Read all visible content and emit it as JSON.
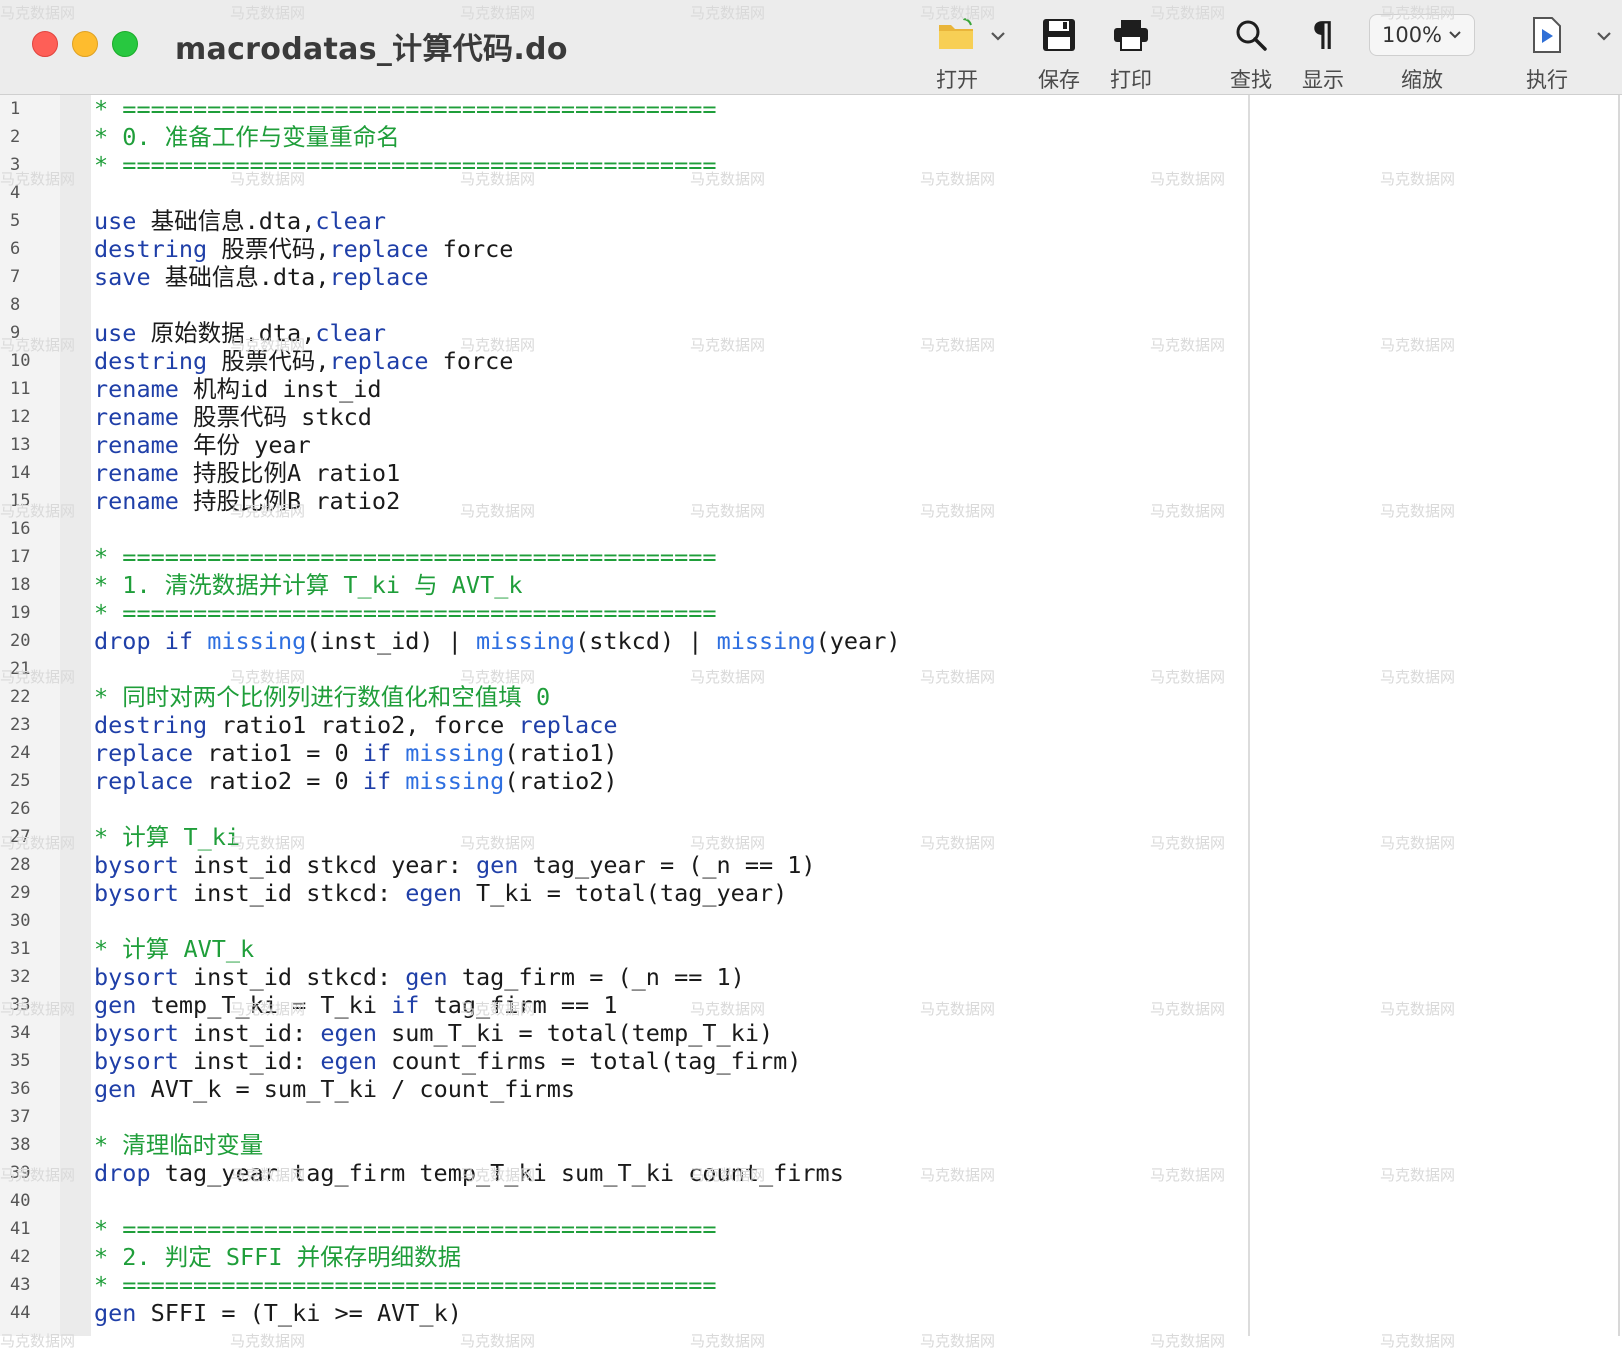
{
  "window": {
    "title": "macrodatas_计算代码.do"
  },
  "toolbar": {
    "open_label": "打开",
    "save_label": "保存",
    "print_label": "打印",
    "find_label": "查找",
    "show_label": "显示",
    "zoom_label": "缩放",
    "zoom_value": "100%",
    "run_label": "执行"
  },
  "watermark_text": "马克数据网",
  "colors": {
    "keyword": "#1f3fa8",
    "function": "#2e6fe0",
    "comment": "#1f9e3a",
    "text": "#1a1a1a"
  },
  "editor": {
    "lines": [
      [
        [
          "c",
          "* =========================================="
        ]
      ],
      [
        [
          "c",
          "* 0. 准备工作与变量重命名"
        ]
      ],
      [
        [
          "c",
          "* =========================================="
        ]
      ],
      [],
      [
        [
          "k",
          "use"
        ],
        [
          "p",
          " 基础信息.dta,"
        ],
        [
          "k",
          "clear"
        ]
      ],
      [
        [
          "k",
          "destring"
        ],
        [
          "p",
          " 股票代码,"
        ],
        [
          "k",
          "replace"
        ],
        [
          "p",
          " force"
        ]
      ],
      [
        [
          "k",
          "save"
        ],
        [
          "p",
          " 基础信息.dta,"
        ],
        [
          "k",
          "replace"
        ]
      ],
      [],
      [
        [
          "k",
          "use"
        ],
        [
          "p",
          " 原始数据.dta,"
        ],
        [
          "k",
          "clear"
        ]
      ],
      [
        [
          "k",
          "destring"
        ],
        [
          "p",
          " 股票代码,"
        ],
        [
          "k",
          "replace"
        ],
        [
          "p",
          " force"
        ]
      ],
      [
        [
          "k",
          "rename"
        ],
        [
          "p",
          " 机构id inst_id"
        ]
      ],
      [
        [
          "k",
          "rename"
        ],
        [
          "p",
          " 股票代码 stkcd"
        ]
      ],
      [
        [
          "k",
          "rename"
        ],
        [
          "p",
          " 年份 year"
        ]
      ],
      [
        [
          "k",
          "rename"
        ],
        [
          "p",
          " 持股比例A ratio1"
        ]
      ],
      [
        [
          "k",
          "rename"
        ],
        [
          "p",
          " 持股比例B ratio2"
        ]
      ],
      [],
      [
        [
          "c",
          "* =========================================="
        ]
      ],
      [
        [
          "c",
          "* 1. 清洗数据并计算 T_ki 与 AVT_k"
        ]
      ],
      [
        [
          "c",
          "* =========================================="
        ]
      ],
      [
        [
          "k",
          "drop"
        ],
        [
          "p",
          " "
        ],
        [
          "k",
          "if"
        ],
        [
          "p",
          " "
        ],
        [
          "f",
          "missing"
        ],
        [
          "p",
          "(inst_id) | "
        ],
        [
          "f",
          "missing"
        ],
        [
          "p",
          "(stkcd) | "
        ],
        [
          "f",
          "missing"
        ],
        [
          "p",
          "(year)"
        ]
      ],
      [],
      [
        [
          "c",
          "* 同时对两个比例列进行数值化和空值填 0"
        ]
      ],
      [
        [
          "k",
          "destring"
        ],
        [
          "p",
          " ratio1 ratio2, force "
        ],
        [
          "k",
          "replace"
        ]
      ],
      [
        [
          "k",
          "replace"
        ],
        [
          "p",
          " ratio1 = 0 "
        ],
        [
          "k",
          "if"
        ],
        [
          "p",
          " "
        ],
        [
          "f",
          "missing"
        ],
        [
          "p",
          "(ratio1)"
        ]
      ],
      [
        [
          "k",
          "replace"
        ],
        [
          "p",
          " ratio2 = 0 "
        ],
        [
          "k",
          "if"
        ],
        [
          "p",
          " "
        ],
        [
          "f",
          "missing"
        ],
        [
          "p",
          "(ratio2)"
        ]
      ],
      [],
      [
        [
          "c",
          "* 计算 T_ki"
        ]
      ],
      [
        [
          "k",
          "bysort"
        ],
        [
          "p",
          " inst_id stkcd year: "
        ],
        [
          "k",
          "gen"
        ],
        [
          "p",
          " tag_year = (_n == 1)"
        ]
      ],
      [
        [
          "k",
          "bysort"
        ],
        [
          "p",
          " inst_id stkcd: "
        ],
        [
          "k",
          "egen"
        ],
        [
          "p",
          " T_ki = total(tag_year)"
        ]
      ],
      [],
      [
        [
          "c",
          "* 计算 AVT_k"
        ]
      ],
      [
        [
          "k",
          "bysort"
        ],
        [
          "p",
          " inst_id stkcd: "
        ],
        [
          "k",
          "gen"
        ],
        [
          "p",
          " tag_firm = (_n == 1)"
        ]
      ],
      [
        [
          "k",
          "gen"
        ],
        [
          "p",
          " temp_T_ki = T_ki "
        ],
        [
          "k",
          "if"
        ],
        [
          "p",
          " tag_firm == 1"
        ]
      ],
      [
        [
          "k",
          "bysort"
        ],
        [
          "p",
          " inst_id: "
        ],
        [
          "k",
          "egen"
        ],
        [
          "p",
          " sum_T_ki = total(temp_T_ki)"
        ]
      ],
      [
        [
          "k",
          "bysort"
        ],
        [
          "p",
          " inst_id: "
        ],
        [
          "k",
          "egen"
        ],
        [
          "p",
          " count_firms = total(tag_firm)"
        ]
      ],
      [
        [
          "k",
          "gen"
        ],
        [
          "p",
          " AVT_k = sum_T_ki / count_firms"
        ]
      ],
      [],
      [
        [
          "c",
          "* 清理临时变量"
        ]
      ],
      [
        [
          "k",
          "drop"
        ],
        [
          "p",
          " tag_year tag_firm temp_T_ki sum_T_ki count_firms"
        ]
      ],
      [],
      [
        [
          "c",
          "* =========================================="
        ]
      ],
      [
        [
          "c",
          "* 2. 判定 SFFI 并保存明细数据"
        ]
      ],
      [
        [
          "c",
          "* =========================================="
        ]
      ],
      [
        [
          "k",
          "gen"
        ],
        [
          "p",
          " SFFI = (T_ki >= AVT_k)"
        ]
      ]
    ]
  }
}
